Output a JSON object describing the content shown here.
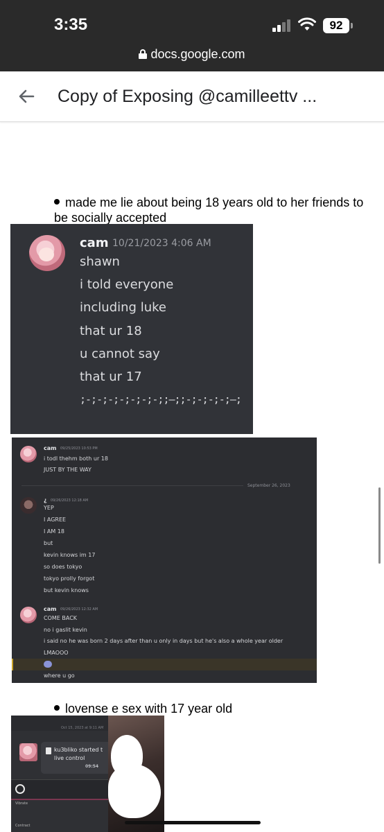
{
  "status_bar": {
    "time": "3:35",
    "battery": "92",
    "url": "docs.google.com"
  },
  "doc": {
    "title": "Copy of Exposing @camilleettv ...",
    "bullets": [
      "made me lie about being 18 years old to her friends to be socially accepted",
      "lovense e sex with 17 year old"
    ]
  },
  "shot1": {
    "username": "cam",
    "timestamp": "10/21/2023 4:06 AM",
    "messages": [
      "shawn",
      "i told everyone",
      "including luke",
      "that ur 18",
      "u cannot say",
      "that ur 17"
    ],
    "emote": ";-;-;-;-;-;-;-;;—;;-;-;-;-;—;"
  },
  "shot2": {
    "groups": [
      {
        "name": "cam",
        "timestamp": "09/25/2023 10:53 PM",
        "messages": [
          "i todl thehm both ur 18",
          "JUST BY THE WAY"
        ]
      },
      {
        "name": "¿",
        "timestamp": "09/26/2023 12:18 AM",
        "messages": [
          "YEP",
          "I AGREE",
          "I AM 18",
          "but",
          "kevin knows im 17",
          "so does tokyo",
          "tokyo prolly forgot",
          "but kevin knows"
        ]
      },
      {
        "name": "cam",
        "timestamp": "09/26/2023 12:32 AM",
        "messages": [
          "COME BACK",
          "no i gaslit kevin",
          "i said no he was born 2 days after than u only in days but he's also a whole year older",
          "LMAOOO",
          "where u go"
        ]
      }
    ],
    "date_divider": "September 26, 2023"
  },
  "shot3": {
    "date_label": "Oct 15, 2023 at 9:11 AM",
    "card_text_line1": "ku3bliko started t",
    "card_text_line2": "live control",
    "card_time": "09:54",
    "bar_label_1": "Vibrate",
    "bar_label_2": "Contract"
  },
  "colors": {
    "discord_bg": "#313338",
    "statusbar_bg": "#2a2a2a",
    "doc_bg": "#ffffff"
  }
}
